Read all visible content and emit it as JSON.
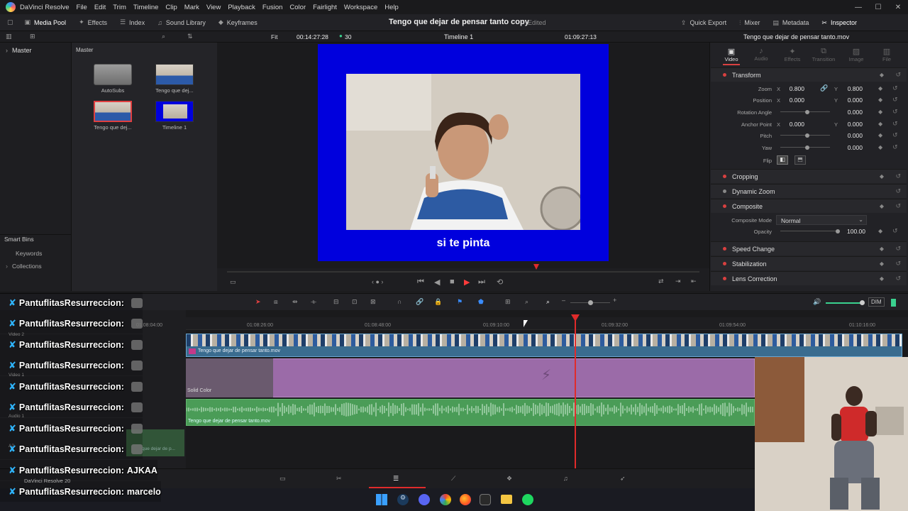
{
  "menubar": {
    "app_name": "DaVinci Resolve",
    "items": [
      "File",
      "Edit",
      "Trim",
      "Timeline",
      "Clip",
      "Mark",
      "View",
      "Playback",
      "Fusion",
      "Color",
      "Fairlight",
      "Workspace",
      "Help"
    ]
  },
  "toolbar": {
    "left": [
      {
        "label": "Media Pool",
        "icon": "media-pool-icon",
        "active": true
      },
      {
        "label": "Effects",
        "icon": "effects-icon"
      },
      {
        "label": "Index",
        "icon": "index-icon"
      },
      {
        "label": "Sound Library",
        "icon": "sound-library-icon"
      },
      {
        "label": "Keyframes",
        "icon": "keyframes-icon"
      }
    ],
    "project_title": "Tengo que dejar de pensar tanto copy",
    "project_status": "Edited",
    "right": [
      {
        "label": "Quick Export",
        "icon": "export-icon"
      },
      {
        "label": "Mixer",
        "icon": "mixer-icon"
      },
      {
        "label": "Metadata",
        "icon": "metadata-icon"
      },
      {
        "label": "Inspector",
        "icon": "inspector-icon",
        "active": true
      }
    ]
  },
  "viewer_bar": {
    "fit": "Fit",
    "source_timecode": "00:14:27:28",
    "fps": "30",
    "timeline_name": "Timeline 1",
    "record_timecode": "01:09:27:13",
    "clip_name": "Tengo que dejar de pensar tanto.mov"
  },
  "bins": {
    "master": "Master",
    "smart_bins": "Smart Bins",
    "smart_items": [
      "Keywords",
      "Collections"
    ]
  },
  "media_pool": {
    "header": "Master",
    "clips": [
      {
        "name": "AutoSubs",
        "kind": "folder"
      },
      {
        "name": "Tengo que dej...",
        "kind": "video"
      },
      {
        "name": "Tengo que dej...",
        "kind": "video-selected"
      },
      {
        "name": "Timeline 1",
        "kind": "timeline"
      }
    ]
  },
  "viewer": {
    "subtitle": "si te pinta"
  },
  "inspector": {
    "tabs": [
      "Video",
      "Audio",
      "Effects",
      "Transition",
      "Image",
      "File"
    ],
    "active_tab": "Video",
    "transform_title": "Transform",
    "props": {
      "zoom": {
        "label": "Zoom",
        "x": "0.800",
        "y": "0.800"
      },
      "position": {
        "label": "Position",
        "x": "0.000",
        "y": "0.000"
      },
      "rotation": {
        "label": "Rotation Angle",
        "v": "0.000"
      },
      "anchor": {
        "label": "Anchor Point",
        "x": "0.000",
        "y": "0.000"
      },
      "pitch": {
        "label": "Pitch",
        "v": "0.000"
      },
      "yaw": {
        "label": "Yaw",
        "v": "0.000"
      },
      "flip": {
        "label": "Flip"
      }
    },
    "sections": [
      {
        "name": "Cropping",
        "enabled": true
      },
      {
        "name": "Dynamic Zoom",
        "enabled": false
      },
      {
        "name": "Composite",
        "enabled": true
      }
    ],
    "composite_mode_label": "Composite Mode",
    "composite_mode_value": "Normal",
    "opacity_label": "Opacity",
    "opacity_value": "100.00",
    "sections2": [
      {
        "name": "Speed Change",
        "enabled": true
      },
      {
        "name": "Stabilization",
        "enabled": true
      },
      {
        "name": "Lens Correction",
        "enabled": true
      }
    ],
    "axis_x": "X",
    "axis_y": "Y"
  },
  "timeline": {
    "ruler": [
      "01:08:26:00",
      "01:08:48:00",
      "01:09:10:00",
      "01:09:32:00",
      "01:09:54:00",
      "01:10:16:00"
    ],
    "tracks": {
      "video2": "Video 2",
      "video1": "Video 1",
      "audio1": "Audio 1",
      "a2": "A2"
    },
    "clips": {
      "v2_clip": "Tengo que dejar de pensar tanto.mov",
      "v1_clip": "Solid Color",
      "a1_clip": "Tengo que dejar de pensar tanto.mov",
      "a2_clip": "que dejar de p..."
    },
    "volume_label": "DIM"
  },
  "pages_footer": {
    "app_version": "DaVinci Resolve 20"
  },
  "chat": [
    {
      "user": "PantuflitasResurreccion:",
      "message": ""
    },
    {
      "user": "PantuflitasResurreccion:",
      "message": ""
    },
    {
      "user": "PantuflitasResurreccion:",
      "message": ""
    },
    {
      "user": "PantuflitasResurreccion:",
      "message": ""
    },
    {
      "user": "PantuflitasResurreccion:",
      "message": ""
    },
    {
      "user": "PantuflitasResurreccion:",
      "message": ""
    },
    {
      "user": "PantuflitasResurreccion:",
      "message": ""
    },
    {
      "user": "PantuflitasResurreccion:",
      "message": ""
    },
    {
      "user": "PantuflitasResurreccion:",
      "message": "AJKAA"
    },
    {
      "user": "PantuflitasResurreccion:",
      "message": "marcelo"
    }
  ],
  "colors": {
    "accent_red": "#e02b2b",
    "video_blue": "#0000dd",
    "track_v2": "#3a6c8f",
    "track_v1": "#9b6ba8",
    "track_a1": "#4a9c57",
    "chat_x": "#2fb5ff"
  }
}
